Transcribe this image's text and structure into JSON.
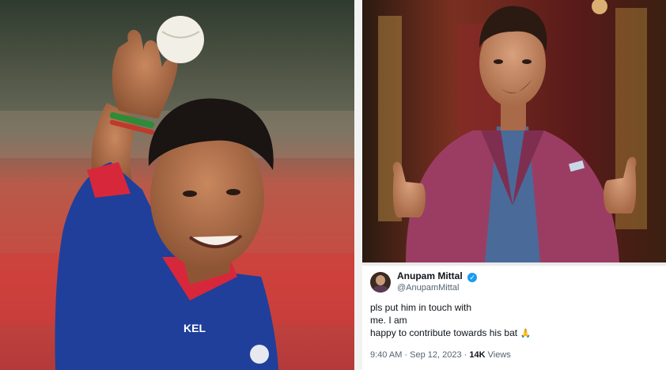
{
  "tweet": {
    "display_name": "Anupam Mittal",
    "handle": "@AnupamMittal",
    "lines": [
      "pls put him in touch with",
      "me. I am",
      "happy to contribute towards his bat"
    ],
    "time": "9:40 AM",
    "separator": "·",
    "date": "Sep 12, 2023",
    "separator2": "·",
    "views_count": "14K",
    "views_label": "Views"
  },
  "photo_left": {
    "jersey_text": "KEL"
  },
  "colors": {
    "verified": "#1d9bf0",
    "jersey_blue": "#1f3f9a",
    "jersey_red": "#d6283a",
    "blazer": "#9b3d63"
  }
}
